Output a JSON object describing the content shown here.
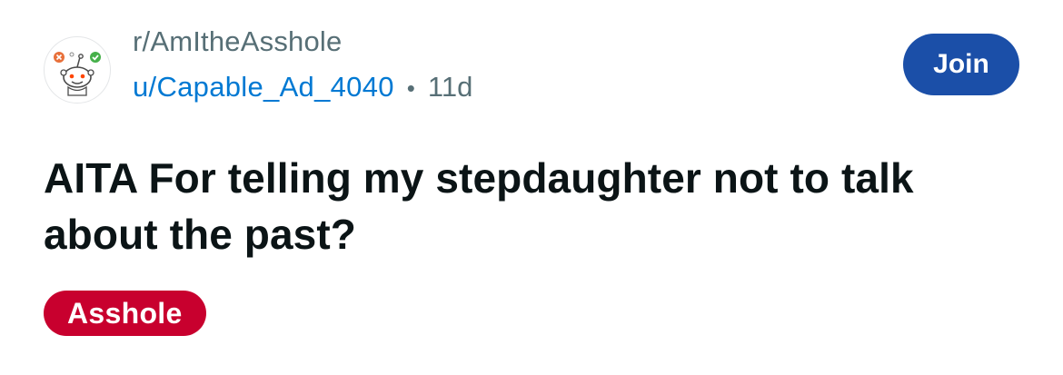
{
  "post_header": {
    "subreddit": "r/AmItheAsshole",
    "username": "u/Capable_Ad_4040",
    "separator": "•",
    "age": "11d",
    "join_label": "Join"
  },
  "post": {
    "title": "AITA For telling my stepdaughter not to talk about the past?",
    "flair": "Asshole"
  },
  "icons": {
    "avatar": "subreddit-avatar-icon"
  },
  "colors": {
    "join_button": "#1b4fa8",
    "username_link": "#0079d3",
    "flair_background": "#c8002e",
    "muted_text": "#576f76",
    "title_text": "#0b1416"
  }
}
